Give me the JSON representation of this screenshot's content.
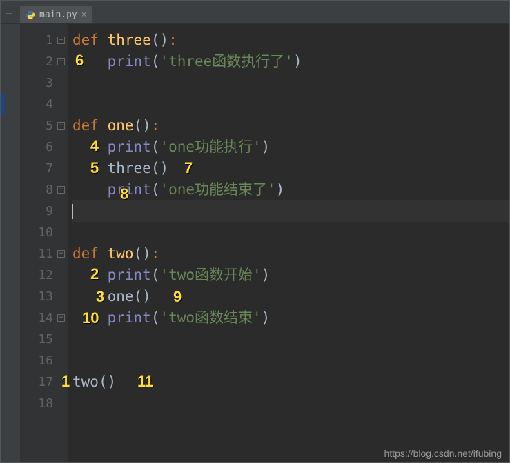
{
  "tab": {
    "filename": "main.py",
    "close_glyph": "×"
  },
  "lines": {
    "l1": {
      "num": "1"
    },
    "l2": {
      "num": "2"
    },
    "l3": {
      "num": "3"
    },
    "l4": {
      "num": "4"
    },
    "l5": {
      "num": "5"
    },
    "l6": {
      "num": "6"
    },
    "l7": {
      "num": "7"
    },
    "l8": {
      "num": "8"
    },
    "l9": {
      "num": "9"
    },
    "l10": {
      "num": "10"
    },
    "l11": {
      "num": "11"
    },
    "l12": {
      "num": "12"
    },
    "l13": {
      "num": "13"
    },
    "l14": {
      "num": "14"
    },
    "l15": {
      "num": "15"
    },
    "l16": {
      "num": "16"
    },
    "l17": {
      "num": "17"
    },
    "l18": {
      "num": "18"
    }
  },
  "code": {
    "def": "def",
    "three_fn": "three",
    "one_fn": "one",
    "two_fn": "two",
    "print": "print",
    "three_call": "three",
    "one_call": "one",
    "two_call": "two",
    "empty_parens": "()",
    "colon": ":",
    "open_p": "(",
    "close_p": ")",
    "str_three": "'three函数执行了'",
    "str_one_start": "'one功能执行'",
    "str_one_end": "'one功能结束了'",
    "str_two_start": "'two函数开始'",
    "str_two_end": "'two函数结束'"
  },
  "annotations": {
    "a1": "1",
    "a2": "2",
    "a3": "3",
    "a4": "4",
    "a5": "5",
    "a6": "6",
    "a7": "7",
    "a8": "8",
    "a9": "9",
    "a10": "10",
    "a11": "11"
  },
  "watermark": "https://blog.csdn.net/ifubing"
}
